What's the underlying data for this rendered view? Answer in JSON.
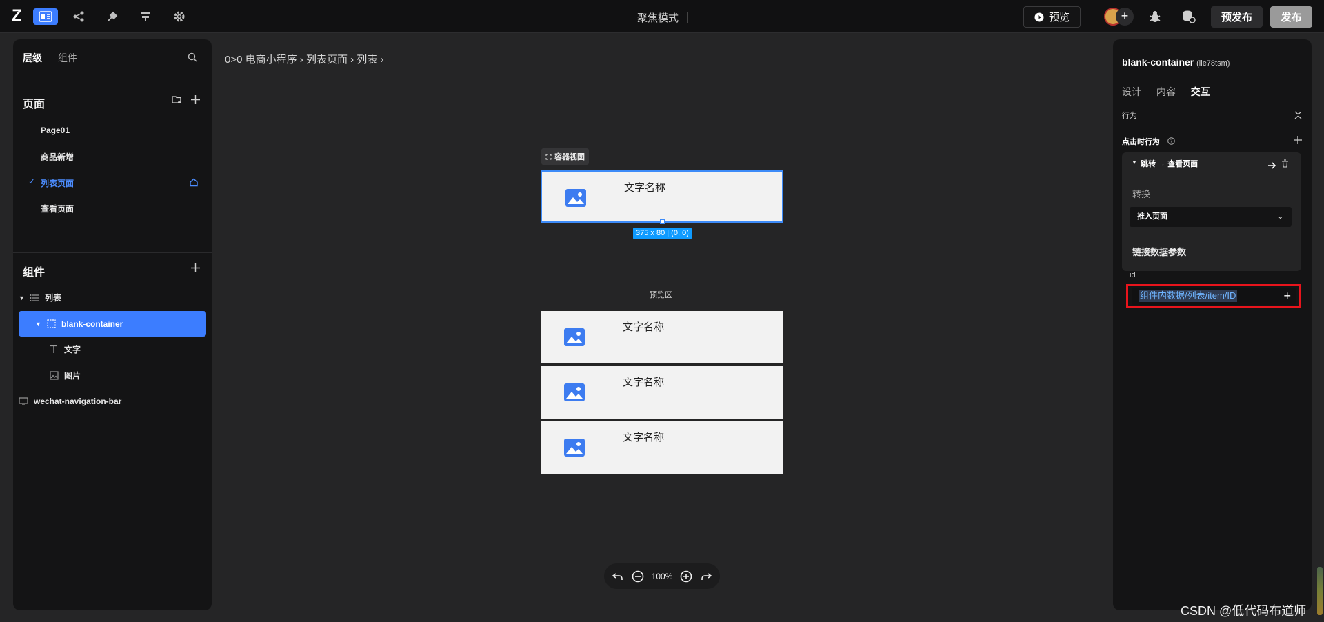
{
  "topbar": {
    "logo": "Z",
    "title": "聚焦模式",
    "preview_label": "预览",
    "prepublish_label": "预发布",
    "publish_label": "发布",
    "avatar_plus": "+",
    "tools": [
      "layout-icon",
      "flow-icon",
      "plugin-icon",
      "deploy-icon",
      "settings-icon"
    ]
  },
  "left": {
    "tabs": [
      "层级",
      "组件"
    ],
    "active_tab": "层级",
    "pages_title": "页面",
    "pages": [
      {
        "label": "Page01",
        "active": false
      },
      {
        "label": "商品新增",
        "active": false
      },
      {
        "label": "列表页面",
        "active": true
      },
      {
        "label": "查看页面",
        "active": false
      }
    ],
    "components_title": "组件",
    "tree": [
      {
        "label": "列表",
        "icon": "list-icon",
        "expanded": true
      },
      {
        "label": "blank-container",
        "icon": "container-icon",
        "expanded": true,
        "selected": true
      },
      {
        "label": "文字",
        "icon": "text-icon"
      },
      {
        "label": "图片",
        "icon": "image-icon"
      },
      {
        "label": "wechat-navigation-bar",
        "icon": "navbar-icon"
      }
    ]
  },
  "canvas": {
    "breadcrumb": "0>0  电商小程序 › 列表页面 › 列表 ›",
    "container_view_label": "容器视图",
    "selected_card_text": "文字名称",
    "size_tag": "375 x 80 | (0, 0)",
    "preview_label": "预览区",
    "preview_cards": [
      "文字名称",
      "文字名称",
      "文字名称"
    ],
    "zoom": "100%"
  },
  "right": {
    "component_name": "blank-container",
    "component_id": "(lie78tsm)",
    "tabs": [
      "设计",
      "内容",
      "交互"
    ],
    "active_tab": "交互",
    "behavior_label": "行为",
    "click_behavior_label": "点击时行为",
    "action_title": "跳转 → 查看页面",
    "transition_label": "转换",
    "transition_value": "推入页面",
    "link_params_label": "链接数据参数",
    "param_key": "id",
    "param_value": "组件内数据/列表/item/ID"
  },
  "watermark": "CSDN @低代码布道师"
}
